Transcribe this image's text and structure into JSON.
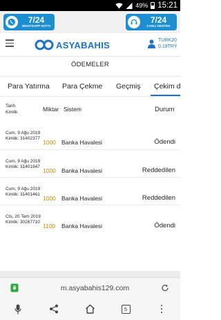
{
  "status_bar": {
    "battery": "49%",
    "time": "15:21"
  },
  "promo": {
    "left": {
      "big": "7/24",
      "small": "WHATSAPP HATTI"
    },
    "right": {
      "big": "7/24",
      "small": "CANLI DESTEK"
    }
  },
  "header": {
    "brand": "ASYABAHIS",
    "user": {
      "name": "TURK20",
      "balance": "0.19TRY"
    }
  },
  "page": {
    "title": "ÖDEMELER"
  },
  "tabs": [
    {
      "label": "Para Yatırma"
    },
    {
      "label": "Para Çekme"
    },
    {
      "label": "Geçmiş"
    },
    {
      "label": "Çekim du"
    }
  ],
  "table": {
    "headers": {
      "date": "Tarih",
      "id": "Kimlik",
      "amount": "Miktar",
      "system": "Sistem",
      "status": "Durum"
    },
    "rows": [
      {
        "date": "Cum, 9 Ağu 2019",
        "id": "Kimlik: 31402377",
        "amount": "1000",
        "system": "Banka Havalesi",
        "status": "Ödendi"
      },
      {
        "date": "Cum, 9 Ağu 2019",
        "id": "Kimlik: 31401947",
        "amount": "1000",
        "system": "Banka Havalesi",
        "status": "Reddedilen"
      },
      {
        "date": "Cum, 9 Ağu 2019",
        "id": "Kimlik: 31401461",
        "amount": "1000",
        "system": "Banka Havalesi",
        "status": "Reddedilen"
      },
      {
        "date": "Cts, 20 Tem 2019",
        "id": "Kimlik: 30267710",
        "amount": "1100",
        "system": "Banka Havalesi",
        "status": "Ödendi"
      }
    ]
  },
  "browser": {
    "url": "m.asyabahis129.com",
    "tab_count": "5"
  },
  "colors": {
    "brand_blue": "#1d74c4",
    "promo_blue": "#1d8fd0",
    "amount_orange": "#d08a00"
  }
}
